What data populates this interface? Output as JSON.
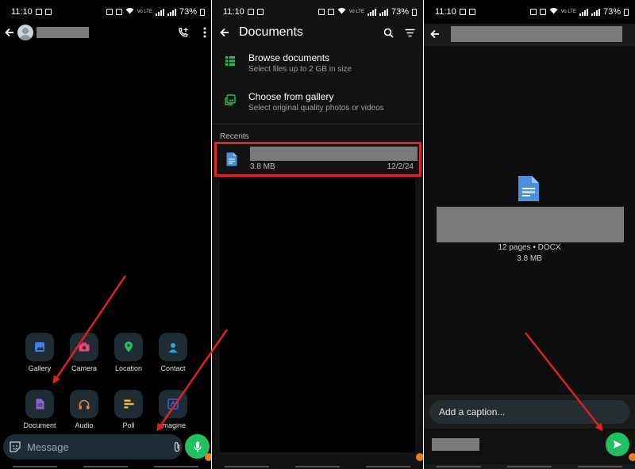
{
  "status_bar": {
    "time": "11:10",
    "battery": "73%",
    "net_label": "Vo LTE"
  },
  "panel1": {
    "attach_options": [
      {
        "label": "Gallery",
        "icon": "gallery-icon",
        "color": "#3f7fe8"
      },
      {
        "label": "Camera",
        "icon": "camera-icon",
        "color": "#e8457a"
      },
      {
        "label": "Location",
        "icon": "location-icon",
        "color": "#21c063"
      },
      {
        "label": "Contact",
        "icon": "contact-icon",
        "color": "#2aa6e0"
      },
      {
        "label": "Document",
        "icon": "document-icon",
        "color": "#8a63d2"
      },
      {
        "label": "Audio",
        "icon": "headphones-icon",
        "color": "#f07b34"
      },
      {
        "label": "Poll",
        "icon": "poll-icon",
        "color": "#f0b435"
      },
      {
        "label": "Imagine",
        "icon": "imagine-icon",
        "color": "#3a5fd9"
      }
    ],
    "message_placeholder": "Message"
  },
  "panel2": {
    "title": "Documents",
    "options": [
      {
        "title": "Browse documents",
        "subtitle": "Select files up to 2 GB in size"
      },
      {
        "title": "Choose from gallery",
        "subtitle": "Select original quality photos or videos"
      }
    ],
    "recents_label": "Recents",
    "recent_file": {
      "size": "3.8 MB",
      "date": "12/2/24"
    }
  },
  "panel3": {
    "doc_meta": "12 pages • DOCX",
    "doc_size": "3.8 MB",
    "caption_placeholder": "Add a caption..."
  },
  "colors": {
    "accent_green": "#21c063",
    "highlight_red": "#d62828",
    "arrow_red": "#e02020"
  }
}
